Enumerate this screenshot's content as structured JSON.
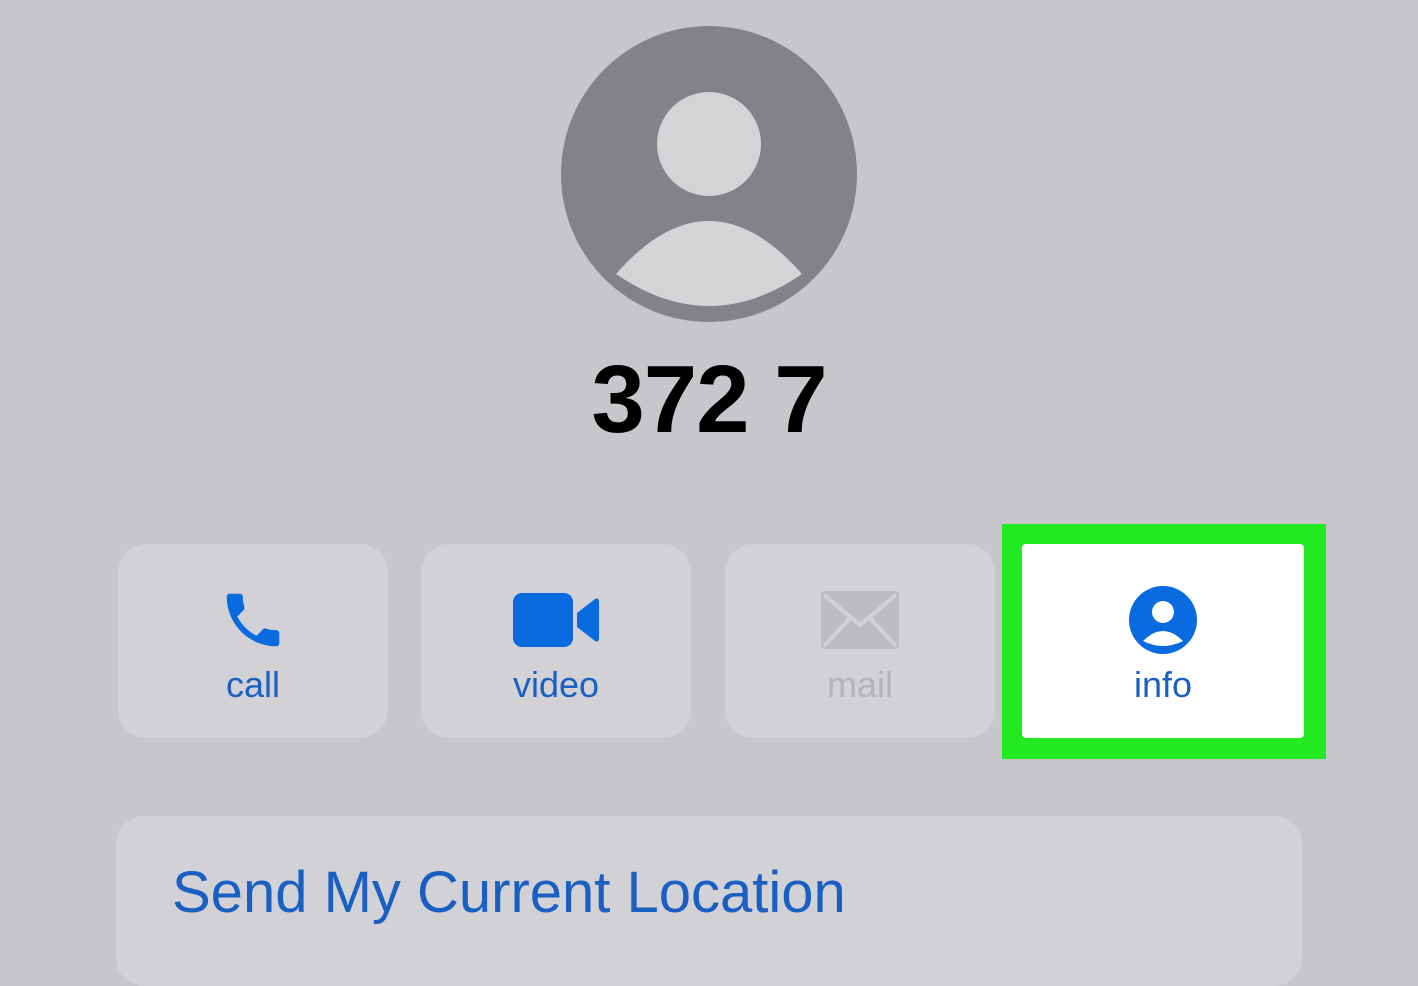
{
  "contact": {
    "name": "372 7",
    "avatar_icon": "person-silhouette-icon"
  },
  "actions": [
    {
      "label": "call",
      "icon": "phone-icon",
      "enabled": true
    },
    {
      "label": "video",
      "icon": "video-camera-icon",
      "enabled": true
    },
    {
      "label": "mail",
      "icon": "envelope-icon",
      "enabled": false
    },
    {
      "label": "info",
      "icon": "person-circle-icon",
      "enabled": true,
      "highlighted": true
    }
  ],
  "location": {
    "label": "Send My Current Location"
  },
  "colors": {
    "background": "#c6c6cb",
    "button_background": "#d2d2d6",
    "accent_blue": "#1a5fc2",
    "icon_blue": "#0a6be0",
    "disabled_gray": "#b4b4b8",
    "avatar_gray": "#818389",
    "highlight_green": "#21ea21"
  }
}
